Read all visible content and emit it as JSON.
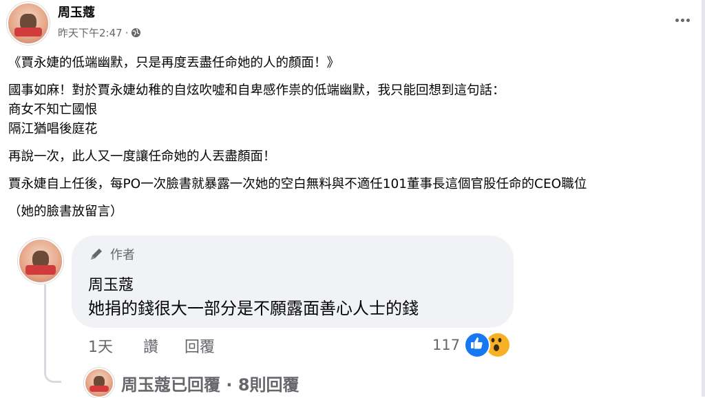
{
  "post": {
    "author": "周玉蔻",
    "timestamp": "昨天下午2:47",
    "separator": "·",
    "privacy_icon": "globe-icon",
    "more_icon": "more-options-icon",
    "lines": [
      "《賈永婕的低端幽默，只是再度丟盡任命她的人的顏面！》",
      "國事如麻！對於賈永婕幼稚的自炫吹噓和自卑感作祟的低端幽默，我只能回想到這句話：",
      "商女不知亡國恨",
      "隔江猶唱後庭花",
      "再說一次，此人又一度讓任命她的人丟盡顏面！",
      "賈永婕自上任後，每PO一次臉書就暴露一次她的空白無料與不適任101董事長這個官股任命的CEO職位",
      "（她的臉書放留言）"
    ]
  },
  "comment": {
    "author_badge": "作者",
    "author_badge_icon": "pencil-icon",
    "name": "周玉蔻",
    "text": "她捐的錢很大一部分是不願露面善心人士的錢",
    "time": "1天",
    "like_label": "讚",
    "reply_label": "回覆",
    "reaction_count": "117",
    "reaction_icons": [
      "like-icon",
      "wow-icon"
    ],
    "replies_summary": "周玉蔻已回覆 · 8則回覆"
  },
  "colors": {
    "text": "#050505",
    "secondary_text": "#65676b",
    "bubble_bg": "#f0f2f5",
    "like_blue": "#1877f2",
    "wow_yellow": "#f7b125"
  }
}
